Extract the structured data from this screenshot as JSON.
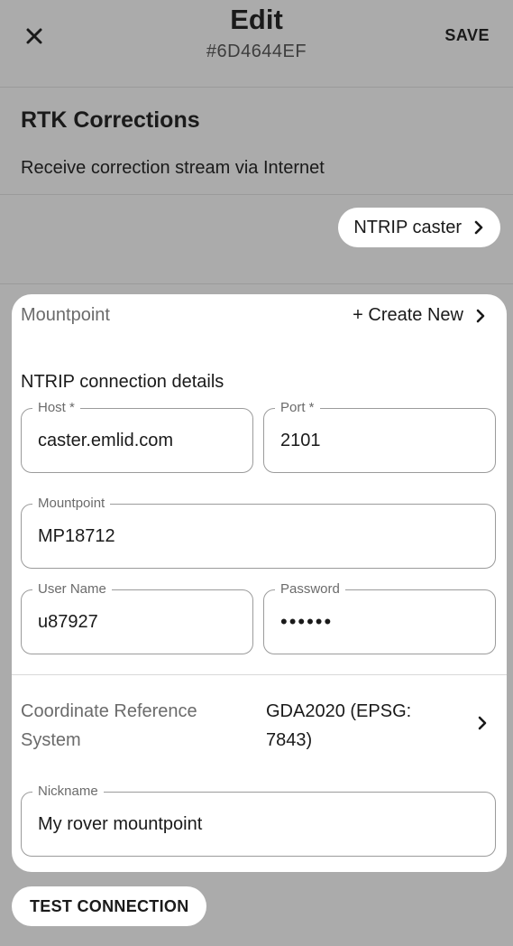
{
  "header": {
    "title": "Edit",
    "subtitle": "#6D4644EF",
    "save_label": "SAVE",
    "close_icon": "close-icon"
  },
  "rtk": {
    "title": "RTK Corrections",
    "description": "Receive correction stream via Internet",
    "source_button": "NTRIP caster"
  },
  "mountpoint": {
    "label": "Mountpoint",
    "create_new": "+ Create New",
    "connection_details": "NTRIP connection details",
    "fields": {
      "host": {
        "label": "Host *",
        "value": "caster.emlid.com"
      },
      "port": {
        "label": "Port *",
        "value": "2101"
      },
      "mountpoint": {
        "label": "Mountpoint",
        "value": "MP18712"
      },
      "username": {
        "label": "User Name",
        "value": "u87927"
      },
      "password": {
        "label": "Password",
        "value": "••••••"
      }
    },
    "crs": {
      "label": "Coordinate Reference System",
      "value": "GDA2020 (EPSG: 7843)"
    },
    "nickname": {
      "label": "Nickname",
      "value": "My rover mountpoint"
    }
  },
  "footer": {
    "test_button": "TEST CONNECTION"
  }
}
